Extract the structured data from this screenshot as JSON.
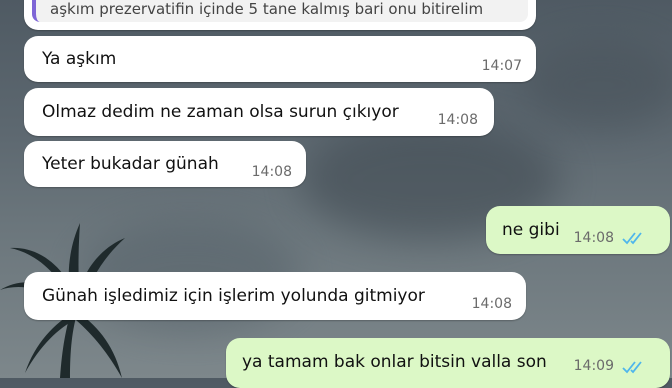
{
  "chat": {
    "quoted_message": "aşkım prezervatifin içinde 5 tane kalmış bari onu bitirelim",
    "messages": [
      {
        "text": "Ya aşkım",
        "time": "14:07",
        "direction": "incoming"
      },
      {
        "text": "Olmaz dedim ne zaman olsa surun çıkıyor",
        "time": "14:08",
        "direction": "incoming"
      },
      {
        "text": "Yeter bukadar günah",
        "time": "14:08",
        "direction": "incoming"
      },
      {
        "text": "ne gibi",
        "time": "14:08",
        "direction": "outgoing",
        "status": "read"
      },
      {
        "text": "Günah işledimiz için işlerim yolunda gitmiyor",
        "time": "14:08",
        "direction": "incoming"
      },
      {
        "text": "ya tamam bak onlar bitsin valla son",
        "time": "14:09",
        "direction": "outgoing",
        "status": "read"
      }
    ]
  },
  "colors": {
    "incoming_bubble": "#ffffff",
    "outgoing_bubble": "#dcf8c6",
    "read_ticks": "#4fb6ec",
    "quote_bar": "#7f66d6"
  }
}
